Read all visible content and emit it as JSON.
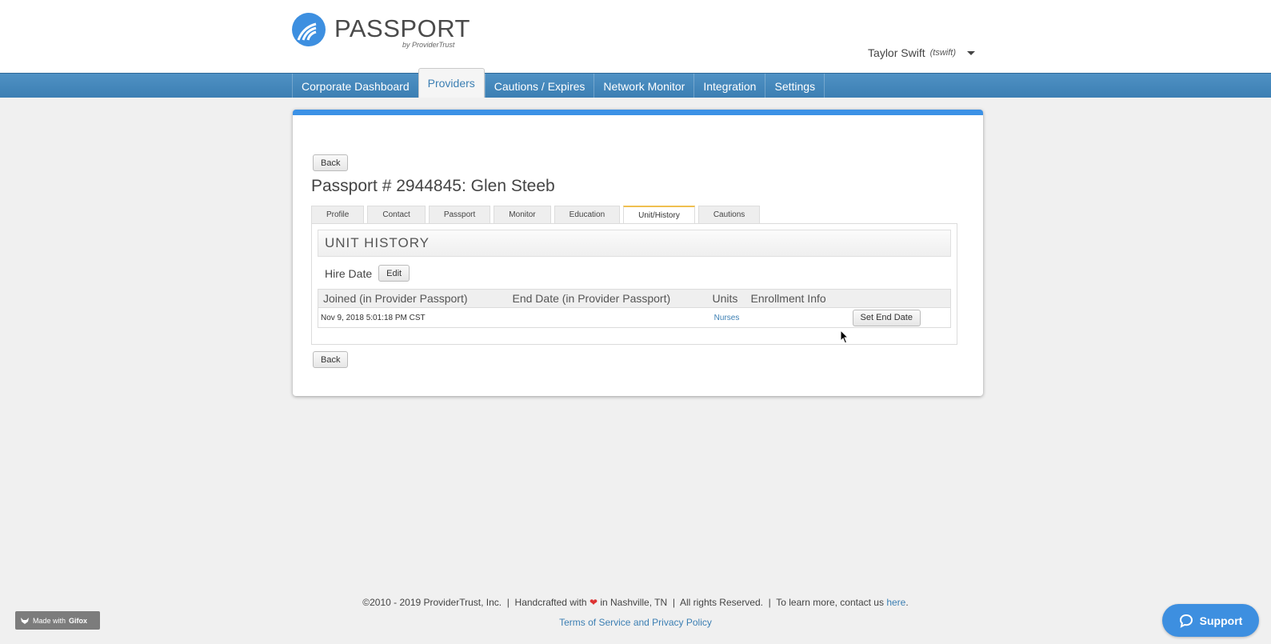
{
  "header": {
    "logo_text": "PASSPORT",
    "logo_sub": "by ProviderTrust",
    "user_name": "Taylor Swift",
    "user_handle": "(tswift)"
  },
  "nav": {
    "items": [
      {
        "label": "Corporate Dashboard",
        "active": false
      },
      {
        "label": "Providers",
        "active": true
      },
      {
        "label": "Cautions / Expires",
        "active": false
      },
      {
        "label": "Network Monitor",
        "active": false
      },
      {
        "label": "Integration",
        "active": false
      },
      {
        "label": "Settings",
        "active": false
      }
    ]
  },
  "page": {
    "back_label": "Back",
    "title": "Passport # 2944845: Glen Steeb",
    "tabs": [
      "Profile",
      "Contact",
      "Passport",
      "Monitor",
      "Education",
      "Unit/History",
      "Cautions"
    ],
    "active_tab": "Unit/History",
    "section_title": "UNIT HISTORY",
    "hire_date_label": "Hire Date",
    "edit_label": "Edit",
    "table": {
      "headers": [
        "Joined (in Provider Passport)",
        "End Date (in Provider Passport)",
        "Units",
        "Enrollment Info",
        ""
      ],
      "rows": [
        {
          "joined": "Nov 9, 2018 5:01:18 PM CST",
          "end_date": "",
          "units": "Nurses",
          "enrollment": "",
          "action": "Set End Date"
        }
      ]
    }
  },
  "footer": {
    "copyright": "©2010 - 2019 ProviderTrust, Inc.",
    "handcrafted_pre": "Handcrafted with",
    "handcrafted_post": "in Nashville, TN",
    "rights": "All rights Reserved.",
    "contact_pre": "To learn more, contact us",
    "contact_link": "here",
    "terms": "Terms of Service and Privacy Policy"
  },
  "badges": {
    "gifox_pre": "Made with",
    "gifox_brand": "Gifox",
    "support_label": "Support"
  },
  "colors": {
    "accent": "#3b91e6",
    "nav": "#3c7fb3",
    "tab_active": "#f0c050"
  }
}
